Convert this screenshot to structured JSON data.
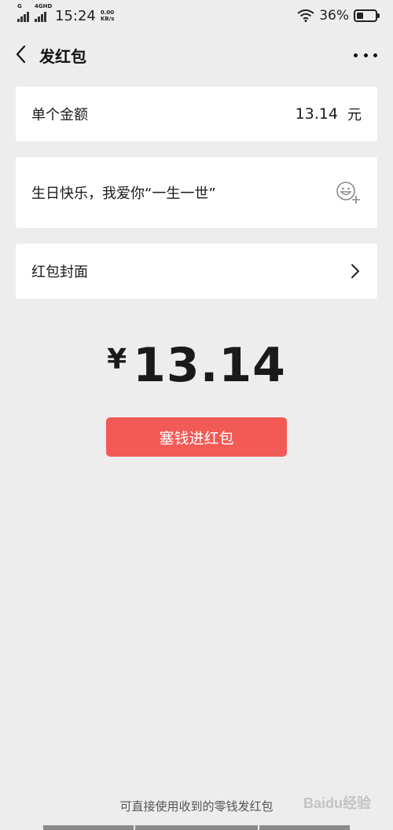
{
  "status_bar": {
    "signal1_label": "G",
    "signal2_label": "4GHD",
    "time": "15:24",
    "speed_value": "0.00",
    "speed_unit": "KB/s",
    "battery_percent": "36%",
    "battery_level": 0.36
  },
  "nav": {
    "title": "发红包"
  },
  "amount_row": {
    "label": "单个金额",
    "value": "13.14",
    "unit": "元"
  },
  "greeting_row": {
    "text": "生日快乐，我爱你“一生一世”"
  },
  "cover_row": {
    "label": "红包封面"
  },
  "total": {
    "currency": "¥",
    "amount": "13.14"
  },
  "send_button": {
    "label": "塞钱进红包",
    "color": "#f25a56"
  },
  "footer": {
    "note": "可直接使用收到的零钱发红包",
    "watermark": "Baidu经验"
  },
  "icons": [
    "back-arrow-icon",
    "more-dots-icon",
    "emoji-add-icon",
    "chevron-right-icon",
    "wifi-icon",
    "battery-icon",
    "signal-icon"
  ]
}
